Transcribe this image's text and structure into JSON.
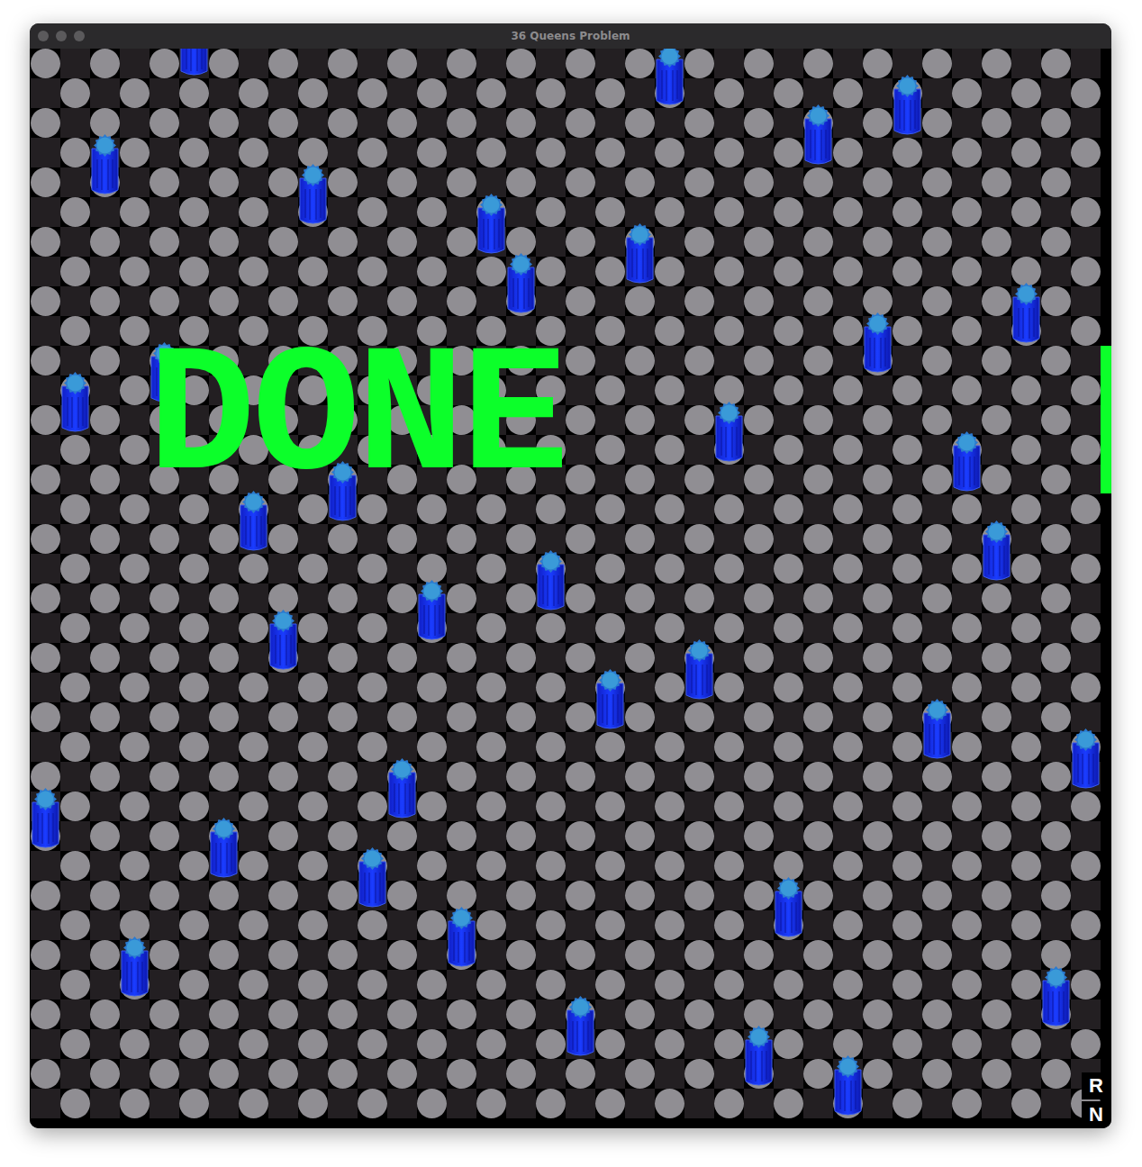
{
  "window": {
    "title": "36 Queens Problem"
  },
  "board": {
    "size": 36,
    "queens": [
      5,
      21,
      29,
      26,
      2,
      9,
      15,
      20,
      16,
      33,
      28,
      4,
      1,
      23,
      31,
      10,
      7,
      32,
      17,
      13,
      8,
      22,
      19,
      30,
      35,
      12,
      0,
      6,
      11,
      25,
      14,
      3,
      34,
      18,
      24,
      27
    ]
  },
  "status": {
    "text": "DONE",
    "solved": true
  },
  "side_labels": [
    "R",
    "N"
  ]
}
